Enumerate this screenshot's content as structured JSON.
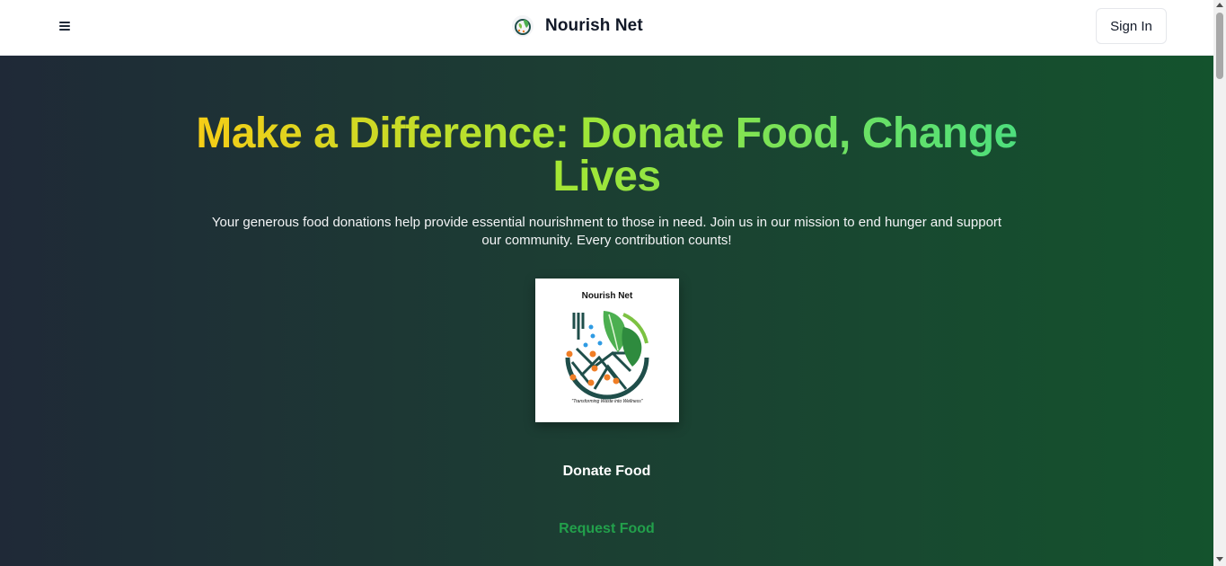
{
  "navbar": {
    "brand_name": "Nourish Net",
    "signin_label": "Sign In",
    "menu_icon": "hamburger-menu-icon"
  },
  "hero": {
    "headline": "Make a Difference: Donate Food, Change Lives",
    "subtext": "Your generous food donations help provide essential nourishment to those in need. Join us in our mission to end hunger and support our community. Every contribution counts!",
    "logo": {
      "title": "Nourish Net",
      "tagline": "\"Transforming Waste into Wellness\""
    },
    "donate_label": "Donate Food",
    "request_label": "Request Food"
  },
  "colors": {
    "headline_gradient": [
      "#facc15",
      "#a3e635",
      "#4ade80"
    ],
    "hero_gradient": [
      "#1f2937",
      "#14532d"
    ],
    "request_link": "#22a04b"
  }
}
